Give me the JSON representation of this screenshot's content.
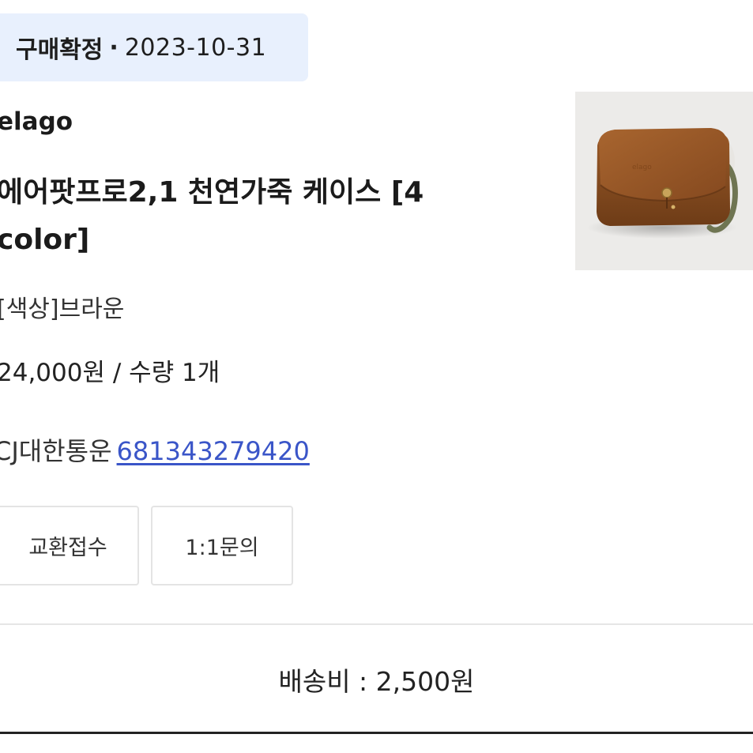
{
  "order": {
    "status": "구매확정",
    "separator": "·",
    "date": "2023-10-31"
  },
  "product": {
    "brand": "elago",
    "title": "에어팟프로2,1 천연가죽 케이스 [4 color]",
    "option": "[색상]브라운",
    "price_quantity": "24,000원 / 수량 1개",
    "image_icon": "leather-airpods-case-image",
    "image_colors": {
      "background": "#ecebe9",
      "leather": "#8a4f22",
      "strap": "#6f7552"
    }
  },
  "delivery": {
    "carrier": "CJ대한통운",
    "tracking_number": "681343279420",
    "link_color": "#3a55c8"
  },
  "actions": {
    "exchange_label": "교환접수",
    "inquiry_label": "1:1문의"
  },
  "shipping": {
    "fee_text": "배송비 : 2,500원"
  },
  "colors": {
    "status_pill_bg": "#e8f0fd",
    "text": "#222222"
  }
}
